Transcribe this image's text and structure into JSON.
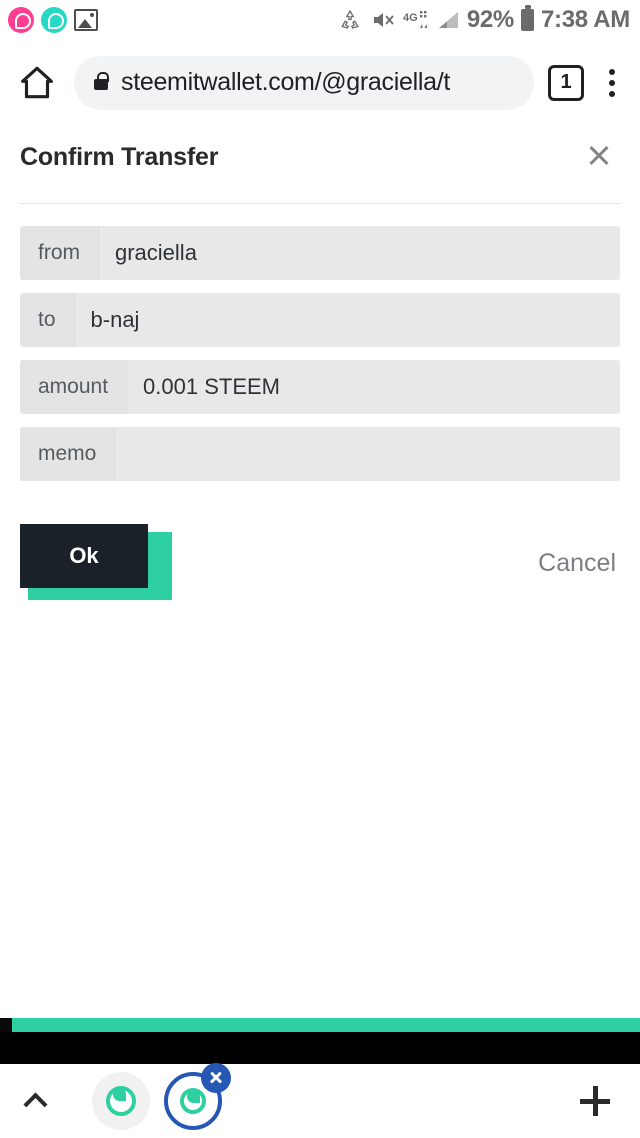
{
  "statusbar": {
    "icons_left": [
      "whatsapp-pink-icon",
      "whatsapp-teal-icon",
      "gallery-icon"
    ],
    "icons_right": [
      "data-saver-icon",
      "volume-mute-icon",
      "network-4g-icon",
      "signal-bars-icon"
    ],
    "network_label": "4G",
    "battery_percent": "92%",
    "time": "7:38 AM"
  },
  "browser": {
    "home_icon": "home-icon",
    "lock_icon": "lock-icon",
    "url": "steemitwallet.com/@graciella/t",
    "tab_count": "1",
    "menu_icon": "kebab-menu-icon"
  },
  "dialog": {
    "title": "Confirm Transfer",
    "close_icon": "close-icon",
    "fields": [
      {
        "label": "from",
        "value": "graciella"
      },
      {
        "label": "to",
        "value": "b-naj"
      },
      {
        "label": "amount",
        "value": "0.001 STEEM"
      },
      {
        "label": "memo",
        "value": ""
      }
    ],
    "ok_label": "Ok",
    "cancel_label": "Cancel"
  },
  "bottombar": {
    "chevron_icon": "chevron-up-icon",
    "tabs": [
      {
        "icon": "steem-logo-icon",
        "active": false
      },
      {
        "icon": "steem-logo-icon",
        "active": true,
        "close_icon": "close-icon"
      }
    ],
    "add_tab_icon": "plus-icon"
  },
  "colors": {
    "accent_teal": "#2ecfa0",
    "button_dark": "#1a2129",
    "tab_active_blue": "#2557b5",
    "field_bg": "#e8e8e8",
    "label_bg": "#e4e4e4"
  }
}
